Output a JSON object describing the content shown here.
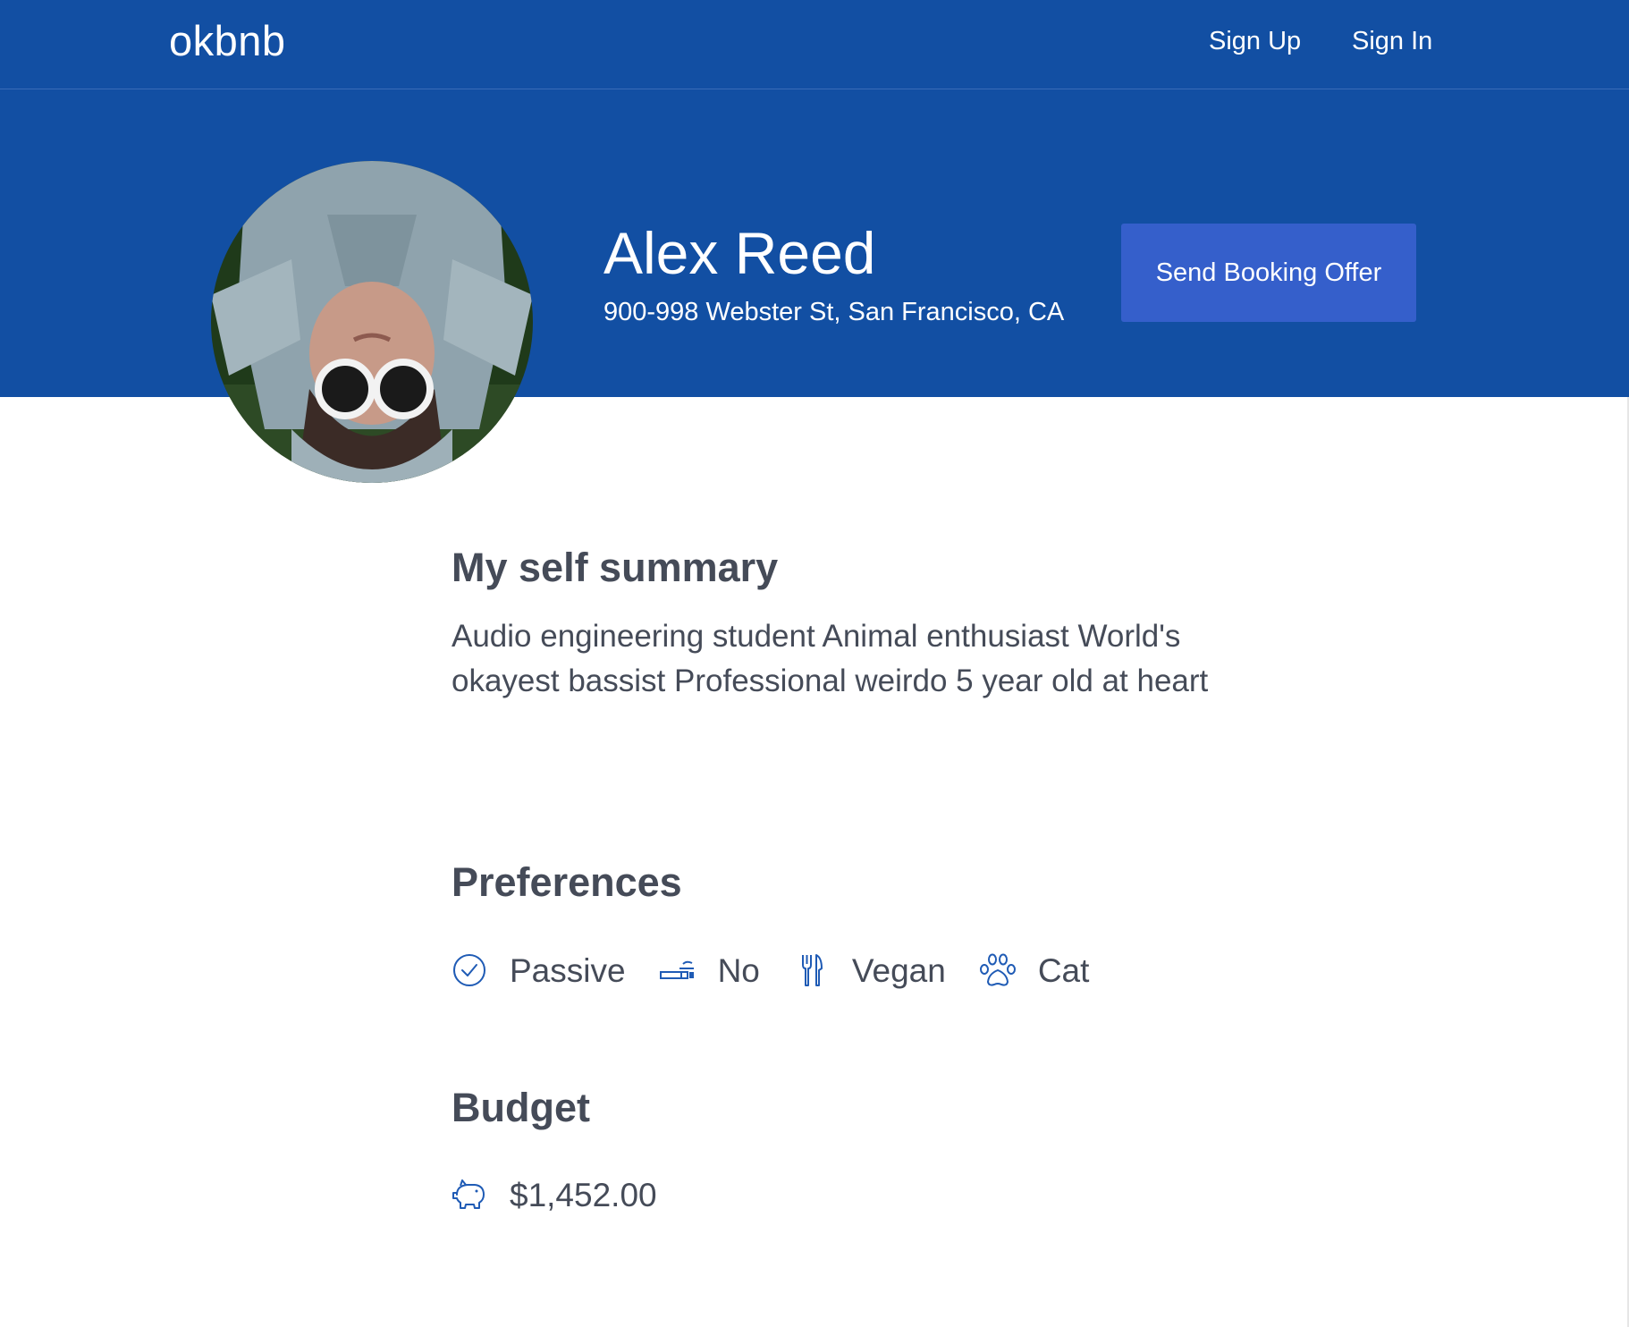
{
  "brand": "okbnb",
  "nav": {
    "sign_up": "Sign Up",
    "sign_in": "Sign In"
  },
  "profile": {
    "name": "Alex Reed",
    "address": "900-998 Webster St, San Francisco, CA",
    "booking_button": "Send Booking Offer"
  },
  "summary": {
    "title": "My self summary",
    "text": "Audio engineering student Animal enthusiast World's okayest bassist Professional weirdo 5 year old at heart"
  },
  "preferences": {
    "title": "Preferences",
    "items": [
      {
        "icon": "check-circle-icon",
        "label": "Passive"
      },
      {
        "icon": "cigarette-icon",
        "label": "No"
      },
      {
        "icon": "fork-knife-icon",
        "label": "Vegan"
      },
      {
        "icon": "paw-icon",
        "label": "Cat"
      }
    ]
  },
  "budget": {
    "title": "Budget",
    "icon": "piggy-bank-icon",
    "value": "$1,452.00"
  },
  "colors": {
    "primary": "#124fa3",
    "button": "#355fcb",
    "text": "#454b58",
    "icon": "#1f5bb5"
  }
}
